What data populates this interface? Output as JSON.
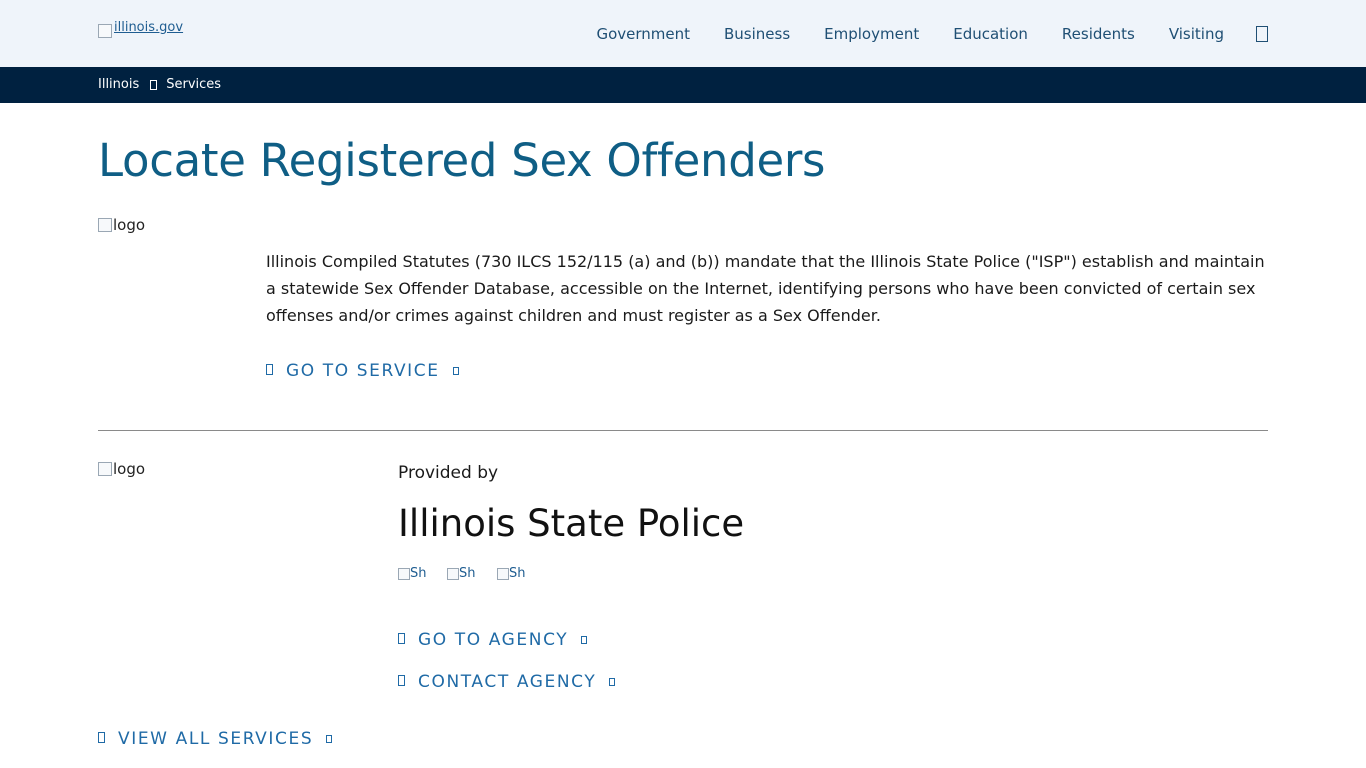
{
  "header": {
    "logo_alt": "illinois.gov",
    "nav": [
      "Government",
      "Business",
      "Employment",
      "Education",
      "Residents",
      "Visiting"
    ],
    "search_icon": "search-icon"
  },
  "breadcrumb": {
    "items": [
      "Illinois",
      "Services"
    ],
    "separator_icon": "chevron-right-icon"
  },
  "main": {
    "title": "Locate Registered Sex Offenders",
    "service_logo_alt": "logo",
    "description": "Illinois Compiled Statutes (730 ILCS 152/115 (a) and (b)) mandate that the Illinois State Police (\"ISP\") establish and maintain a statewide Sex Offender Database, accessible on the Internet, identifying persons who have been convicted of certain sex offenses and/or crimes against children and must register as a Sex Offender.",
    "go_to_service": "GO TO SERVICE"
  },
  "agency": {
    "logo_alt": "logo",
    "provided_by": "Provided by",
    "name": "Illinois State Police",
    "social_alts": [
      "Sh",
      "Sh",
      "Sh"
    ],
    "go_to_agency": "GO TO AGENCY",
    "contact_agency": "CONTACT AGENCY"
  },
  "footer_link": {
    "view_all": "VIEW ALL SERVICES"
  },
  "colors": {
    "topbar_bg": "#eff4fa",
    "breadcrumb_bg": "#002140",
    "title": "#0f5e85",
    "link": "#1f6aa6",
    "nav_text": "#1f4f74"
  }
}
